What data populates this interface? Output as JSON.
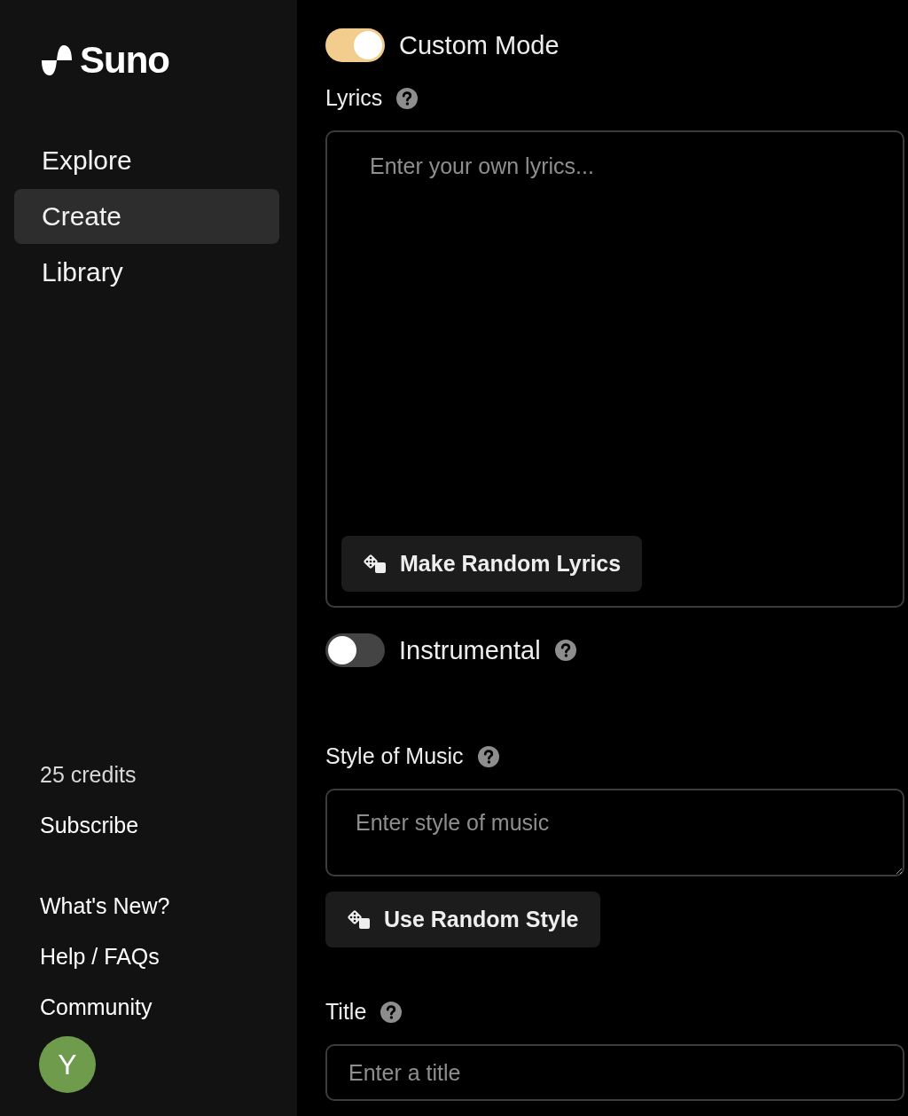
{
  "sidebar": {
    "logo": "Suno",
    "nav": [
      {
        "label": "Explore",
        "selected": false
      },
      {
        "label": "Create",
        "selected": true
      },
      {
        "label": "Library",
        "selected": false
      }
    ],
    "credits": "25 credits",
    "subscribe": "Subscribe",
    "links": [
      "What's New?",
      "Help / FAQs",
      "Community"
    ],
    "avatar": "Y"
  },
  "main": {
    "custom_mode": {
      "label": "Custom Mode",
      "on": true
    },
    "lyrics": {
      "label": "Lyrics",
      "placeholder": "Enter your own lyrics...",
      "button": "Make Random Lyrics"
    },
    "instrumental": {
      "label": "Instrumental",
      "on": false
    },
    "style": {
      "label": "Style of Music",
      "placeholder": "Enter style of music",
      "button": "Use Random Style"
    },
    "title": {
      "label": "Title",
      "placeholder": "Enter a title"
    }
  }
}
